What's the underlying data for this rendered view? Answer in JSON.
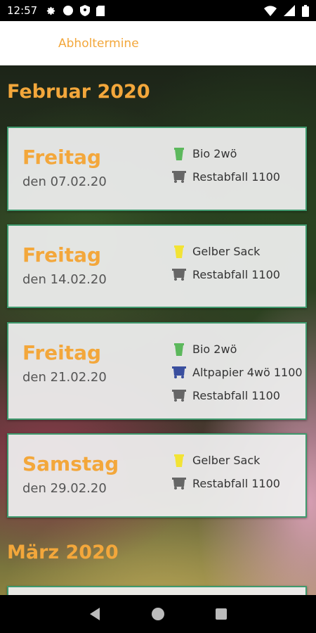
{
  "status": {
    "time": "12:57"
  },
  "appbar": {
    "title": "Abholtermine"
  },
  "colors": {
    "accent": "#f3a73b",
    "card_border": "#3f9a6e",
    "bio": "#5cb85c",
    "gelb": "#f2e335",
    "rest": "#666666",
    "papier": "#3a4f9e"
  },
  "months": [
    {
      "label": "Februar 2020",
      "entries": [
        {
          "day": "Freitag",
          "date": "den 07.02.20",
          "items": [
            {
              "icon": "bio-bin-icon",
              "label": "Bio 2wö"
            },
            {
              "icon": "rest-bin-icon",
              "label": "Restabfall 1100"
            }
          ]
        },
        {
          "day": "Freitag",
          "date": "den 14.02.20",
          "items": [
            {
              "icon": "yellow-bag-icon",
              "label": "Gelber Sack"
            },
            {
              "icon": "rest-bin-icon",
              "label": "Restabfall 1100"
            }
          ]
        },
        {
          "day": "Freitag",
          "date": "den 21.02.20",
          "items": [
            {
              "icon": "bio-bin-icon",
              "label": "Bio 2wö"
            },
            {
              "icon": "paper-bin-icon",
              "label": "Altpapier 4wö 1100"
            },
            {
              "icon": "rest-bin-icon",
              "label": "Restabfall 1100"
            }
          ]
        },
        {
          "day": "Samstag",
          "date": "den 29.02.20",
          "items": [
            {
              "icon": "yellow-bag-icon",
              "label": "Gelber Sack"
            },
            {
              "icon": "rest-bin-icon",
              "label": "Restabfall 1100"
            }
          ]
        }
      ]
    },
    {
      "label": "März 2020",
      "entries": []
    }
  ]
}
